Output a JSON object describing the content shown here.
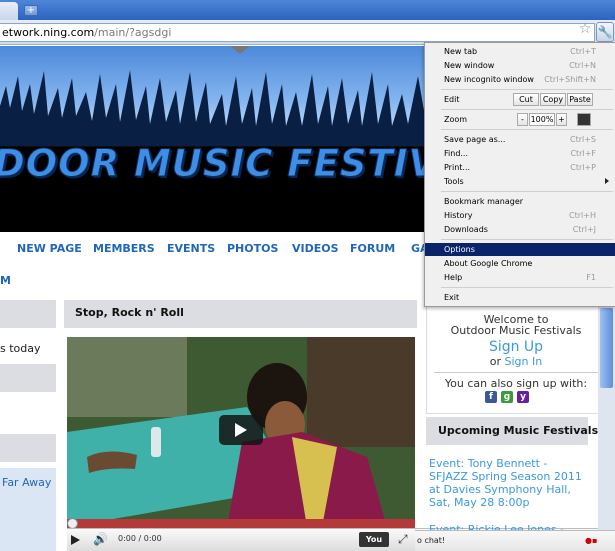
{
  "browser": {
    "url_host": "etwork.ning.com",
    "url_path": "/main/?agsdgi",
    "new_tab_symbol": "+",
    "star_icon": "star-icon",
    "wrench_icon": "wrench-icon"
  },
  "site": {
    "banner_title": "DOOR MUSIC FESTIVALS",
    "nav": [
      "NEW PAGE",
      "MEMBERS",
      "EVENTS",
      "PHOTOS",
      "VIDEOS",
      "FORUM",
      "GA"
    ],
    "nav_sub": "M",
    "left_today": "s today",
    "left_far": "Far Away"
  },
  "main": {
    "section_title": "Stop, Rock n' Roll",
    "video_time": "0:00 / 0:00",
    "youtube_label": "You Tube"
  },
  "sidebar": {
    "welcome_line1": "Welcome to",
    "welcome_line2": "Outdoor Music Festivals",
    "signup": "Sign Up",
    "or": "or ",
    "signin": "Sign In",
    "signup_also": "You can also sign up with:",
    "upcoming_title": "Upcoming Music Festivals",
    "event1": "Event: Tony Bennett - SFJAZZ Spring Season 2011 at Davies Symphony Hall, Sat, May 28 8:00p",
    "event2": "Event: Rickie Lee Jones -",
    "chat": "o chat!"
  },
  "menu": {
    "new_tab": "New tab",
    "new_tab_sc": "Ctrl+T",
    "new_window": "New window",
    "new_window_sc": "Ctrl+N",
    "incognito": "New incognito window",
    "incognito_sc": "Ctrl+Shift+N",
    "edit": "Edit",
    "cut": "Cut",
    "copy": "Copy",
    "paste": "Paste",
    "zoom": "Zoom",
    "zoom_minus": "-",
    "zoom_value": "100%",
    "zoom_plus": "+",
    "save_page": "Save page as...",
    "save_page_sc": "Ctrl+S",
    "find": "Find...",
    "find_sc": "Ctrl+F",
    "print": "Print...",
    "print_sc": "Ctrl+P",
    "tools": "Tools",
    "bookmark_manager": "Bookmark manager",
    "history": "History",
    "history_sc": "Ctrl+H",
    "downloads": "Downloads",
    "downloads_sc": "Ctrl+J",
    "options": "Options",
    "about": "About Google Chrome",
    "help": "Help",
    "help_sc": "F1",
    "exit": "Exit"
  }
}
